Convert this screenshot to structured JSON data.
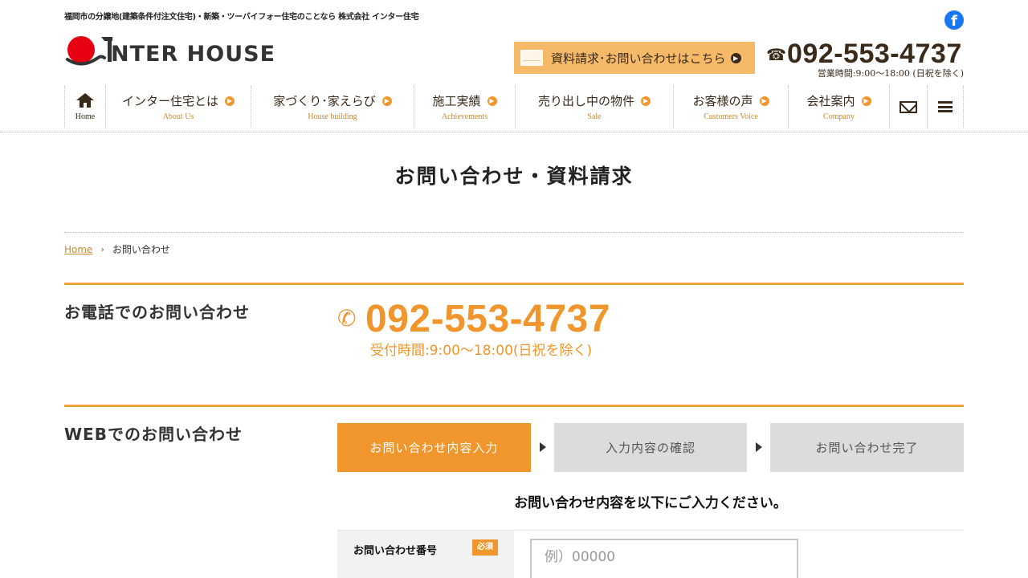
{
  "header": {
    "tagline": "福岡市の分譲地(建築条件付注文住宅)・新築・ツーバイフォー住宅のことなら 株式会社 インター住宅",
    "logo_text": "NTER HOUSE",
    "request_button_label": "資料請求･お問い合わせはこちら",
    "phone_number": "092-553-4737",
    "business_hours": "営業時間:9:00〜18:00 (日祝を除く)",
    "facebook_icon": "facebook-icon"
  },
  "nav": {
    "home_label": "Home",
    "items": [
      {
        "label": "インター住宅とは",
        "sub": "About Us"
      },
      {
        "label": "家づくり･家えらび",
        "sub": "House building"
      },
      {
        "label": "施工実績",
        "sub": "Achievements"
      },
      {
        "label": "売り出し中の物件",
        "sub": "Sale"
      },
      {
        "label": "お客様の声",
        "sub": "Customers Voice"
      },
      {
        "label": "会社案内",
        "sub": "Company"
      }
    ],
    "mail_icon": "mail-icon",
    "menu_icon": "hamburger-menu-icon"
  },
  "page": {
    "title": "お問い合わせ・資料請求"
  },
  "breadcrumb": {
    "home": "Home",
    "current": "お問い合わせ"
  },
  "phone_section": {
    "heading": "お電話でのお問い合わせ",
    "number": "092-553-4737",
    "hours": "受付時間:9:00〜18:00(日祝を除く)"
  },
  "web_section": {
    "heading": "WEBでのお問い合わせ",
    "steps": [
      {
        "label": "お問い合わせ内容入力",
        "state": "active"
      },
      {
        "label": "入力内容の確認",
        "state": "inactive"
      },
      {
        "label": "お問い合わせ完了",
        "state": "inactive"
      }
    ],
    "instruction": "お問い合わせ内容を以下にご入力ください。",
    "fields": [
      {
        "label": "お問い合わせ番号",
        "required_badge": "必須",
        "placeholder": "例）00000",
        "value": ""
      }
    ]
  },
  "colors": {
    "accent": "#f0962c",
    "accent_light": "#f6b968",
    "text_dark": "#3a2a1a",
    "inactive_step": "#dcdcdc"
  }
}
